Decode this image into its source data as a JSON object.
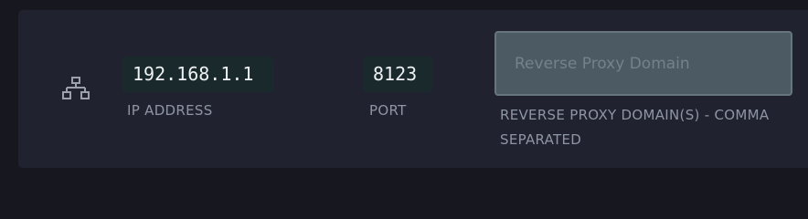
{
  "connection": {
    "icon": "network-icon",
    "ip_address": {
      "value": "192.168.1.1",
      "label": "IP ADDRESS"
    },
    "port": {
      "value": "8123",
      "label": "PORT"
    },
    "reverse_proxy": {
      "value": "",
      "placeholder": "Reverse Proxy Domain",
      "label": "REVERSE PROXY DOMAIN(S) - COMMA SEPARATED"
    }
  },
  "colors": {
    "page_background": "#17171f",
    "card_background": "#21222f",
    "chip_background": "#1a2a2c",
    "input_background": "#4b5a63",
    "label_text": "#8e95a3"
  }
}
